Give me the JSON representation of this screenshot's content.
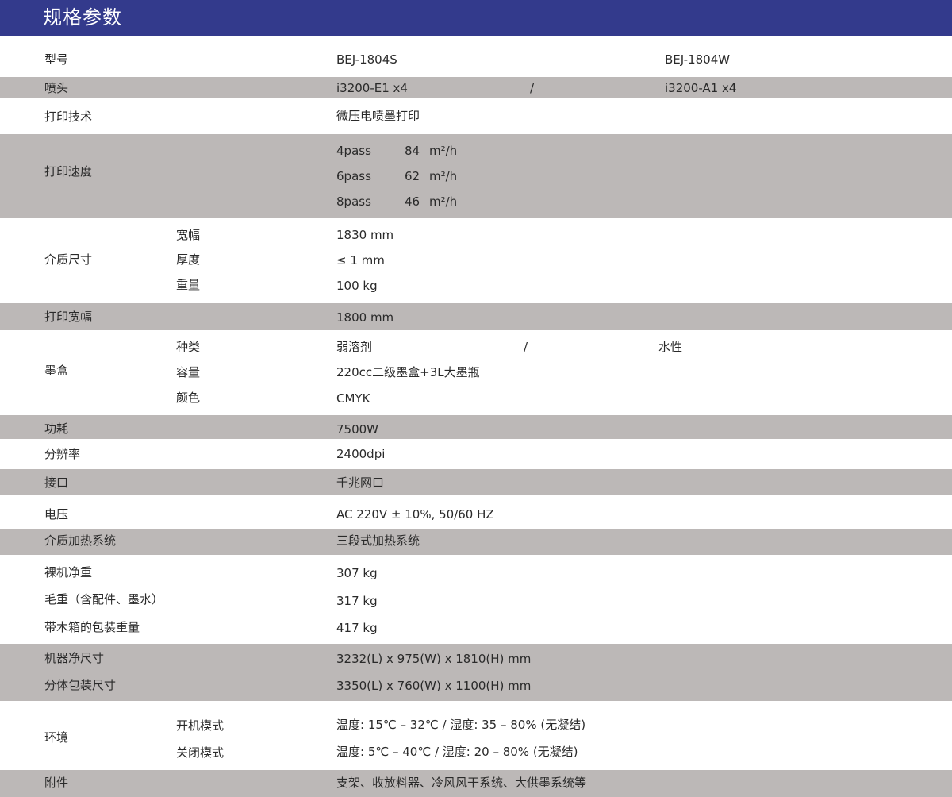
{
  "title": "规格参数",
  "rows": {
    "model": {
      "label": "型号",
      "s": "BEJ-1804S",
      "w": "BEJ-1804W"
    },
    "nozzle": {
      "label": "喷头",
      "s": "i3200-E1 x4",
      "sep": "/",
      "w": "i3200-A1 x4"
    },
    "tech": {
      "label": "打印技术",
      "value": "微压电喷墨打印"
    },
    "speed": {
      "label": "打印速度",
      "items": [
        {
          "mode": "4pass",
          "value": "84",
          "unit": "m²/h"
        },
        {
          "mode": "6pass",
          "value": "62",
          "unit": "m²/h"
        },
        {
          "mode": "8pass",
          "value": "46",
          "unit": "m²/h"
        }
      ]
    },
    "media": {
      "label": "介质尺寸",
      "items": [
        {
          "name": "宽幅",
          "value": "1830 mm"
        },
        {
          "name": "厚度",
          "value": "≤ 1 mm"
        },
        {
          "name": "重量",
          "value": "100 kg"
        }
      ]
    },
    "print_width": {
      "label": "打印宽幅",
      "value": "1800 mm"
    },
    "ink": {
      "label": "墨盒",
      "type_name": "种类",
      "type_s": "弱溶剂",
      "sep": "/",
      "type_w": "水性",
      "capacity_name": "容量",
      "capacity_value": "220cc二级墨盒+3L大墨瓶",
      "color_name": "颜色",
      "color_value": "CMYK"
    },
    "power": {
      "label": "功耗",
      "value": "7500W"
    },
    "resolution": {
      "label": "分辨率",
      "value": "2400dpi"
    },
    "interface": {
      "label": "接口",
      "value": "千兆网口"
    },
    "voltage": {
      "label": "电压",
      "value": "AC 220V ± 10%, 50/60 HZ"
    },
    "heating": {
      "label": "介质加热系统",
      "value": "三段式加热系统"
    },
    "weights": [
      {
        "label": "裸机净重",
        "value": "307 kg"
      },
      {
        "label": "毛重（含配件、墨水）",
        "value": "317 kg"
      },
      {
        "label": "带木箱的包装重量",
        "value": "417 kg"
      }
    ],
    "sizes": [
      {
        "label": "机器净尺寸",
        "value": "3232(L) x 975(W) x 1810(H) mm"
      },
      {
        "label": "分体包装尺寸",
        "value": "3350(L) x 760(W) x 1100(H) mm"
      }
    ],
    "environment": {
      "label": "环境",
      "items": [
        {
          "name": "开机模式",
          "value": "温度: 15℃ – 32℃ / 湿度: 35 – 80% (无凝结)"
        },
        {
          "name": "关闭模式",
          "value": "温度: 5℃ – 40℃ / 湿度: 20 – 80% (无凝结)"
        }
      ]
    },
    "accessories": {
      "label": "附件",
      "value": "支架、收放料器、冷风风干系统、大供墨系统等"
    }
  }
}
